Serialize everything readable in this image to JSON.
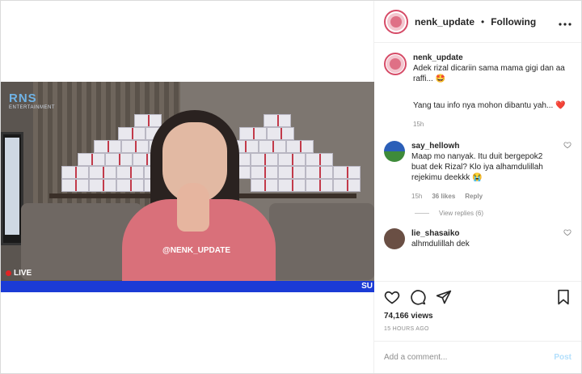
{
  "header": {
    "username": "nenk_update",
    "separator": "•",
    "follow_label": "Following",
    "more_icon": "more-icon"
  },
  "video": {
    "channel_logo": "RNS",
    "channel_sub": "ENTERTAINMENT",
    "watermark": "@NENK_UPDATE",
    "live_label": "LIVE",
    "bar_text": "SU"
  },
  "caption": {
    "username": "nenk_update",
    "line1": "Adek rizal dicariin sama mama gigi dan aa raffi... 🤩",
    "line2": "Yang tau info nya mohon dibantu yah... ❤️",
    "time": "15h"
  },
  "comments": [
    {
      "username": "say_hellowh",
      "text": "Maap mo nanyak. Itu duit bergepok2 buat dek Rizal? Klo iya alhamdulillah rejekimu deekkk 😭",
      "time": "15h",
      "likes": "36 likes",
      "reply": "Reply",
      "view_replies": "View replies (6)"
    },
    {
      "username": "lie_shasaiko",
      "text": "alhmdulillah dek",
      "time": "",
      "likes": "",
      "reply": ""
    }
  ],
  "stats": {
    "views": "74,166 views",
    "ago": "15 HOURS AGO"
  },
  "add_comment": {
    "placeholder": "Add a comment...",
    "post_label": "Post"
  },
  "colors": {
    "live_bar": "#1b3bd6",
    "avatar_ring": "#d64b67",
    "post_disabled": "#b2dffc"
  }
}
